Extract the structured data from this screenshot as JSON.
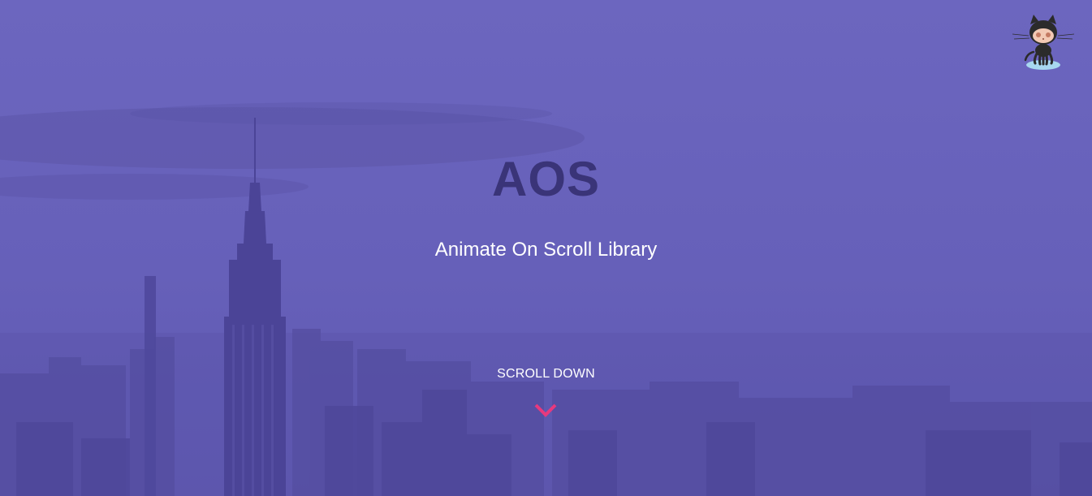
{
  "hero": {
    "title": "AOS",
    "subtitle": "Animate On Scroll Library",
    "scroll_label": "SCROLL DOWN"
  },
  "icons": {
    "github": "octocat-icon",
    "scroll": "chevron-down-icon"
  },
  "colors": {
    "background": "#6660b9",
    "title": "#3a3478",
    "subtitle": "#ffffff",
    "chevron": "#e8397d"
  }
}
